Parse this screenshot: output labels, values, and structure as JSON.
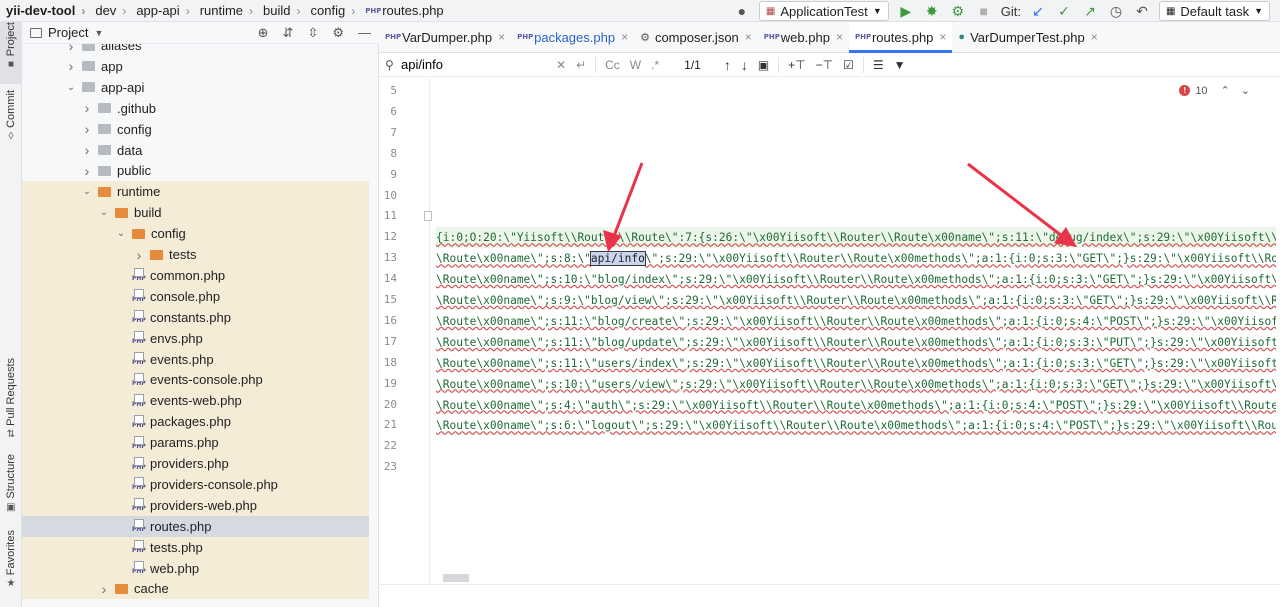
{
  "breadcrumbs": [
    "yii-dev-tool",
    "dev",
    "app-api",
    "runtime",
    "build",
    "config",
    "routes.php"
  ],
  "toolbar": {
    "run_config": "ApplicationTest",
    "git_label": "Git:",
    "default_task": "Default task"
  },
  "left_stripe": {
    "tabs": [
      "Project",
      "Commit",
      "Pull Requests",
      "Structure",
      "Favorites"
    ]
  },
  "project_panel": {
    "title": "Project",
    "tree": [
      {
        "label": "aliases",
        "type": "folder",
        "depth": 2,
        "chevron": "right",
        "color": "grey"
      },
      {
        "label": "app",
        "type": "folder",
        "depth": 2,
        "chevron": "right",
        "color": "grey"
      },
      {
        "label": "app-api",
        "type": "folder",
        "depth": 2,
        "chevron": "down",
        "color": "grey"
      },
      {
        "label": ".github",
        "type": "folder",
        "depth": 3,
        "chevron": "right",
        "color": "grey"
      },
      {
        "label": "config",
        "type": "folder",
        "depth": 3,
        "chevron": "right",
        "color": "grey"
      },
      {
        "label": "data",
        "type": "folder",
        "depth": 3,
        "chevron": "right",
        "color": "grey"
      },
      {
        "label": "public",
        "type": "folder",
        "depth": 3,
        "chevron": "right",
        "color": "grey"
      },
      {
        "label": "runtime",
        "type": "folder",
        "depth": 3,
        "chevron": "down",
        "color": "orange"
      },
      {
        "label": "build",
        "type": "folder",
        "depth": 4,
        "chevron": "down",
        "color": "orange"
      },
      {
        "label": "config",
        "type": "folder",
        "depth": 5,
        "chevron": "down",
        "color": "orange"
      },
      {
        "label": "tests",
        "type": "folder",
        "depth": 6,
        "chevron": "right",
        "color": "orange"
      },
      {
        "label": "common.php",
        "type": "php",
        "depth": 6
      },
      {
        "label": "console.php",
        "type": "php",
        "depth": 6
      },
      {
        "label": "constants.php",
        "type": "php",
        "depth": 6
      },
      {
        "label": "envs.php",
        "type": "php",
        "depth": 6
      },
      {
        "label": "events.php",
        "type": "php",
        "depth": 6
      },
      {
        "label": "events-console.php",
        "type": "php",
        "depth": 6
      },
      {
        "label": "events-web.php",
        "type": "php",
        "depth": 6
      },
      {
        "label": "packages.php",
        "type": "php",
        "depth": 6
      },
      {
        "label": "params.php",
        "type": "php",
        "depth": 6
      },
      {
        "label": "providers.php",
        "type": "php",
        "depth": 6
      },
      {
        "label": "providers-console.php",
        "type": "php",
        "depth": 6
      },
      {
        "label": "providers-web.php",
        "type": "php",
        "depth": 6
      },
      {
        "label": "routes.php",
        "type": "php",
        "depth": 6,
        "selected": true
      },
      {
        "label": "tests.php",
        "type": "php",
        "depth": 6
      },
      {
        "label": "web.php",
        "type": "php",
        "depth": 6
      },
      {
        "label": "cache",
        "type": "folder",
        "depth": 4,
        "chevron": "right",
        "color": "orange"
      }
    ]
  },
  "editor": {
    "tabs": [
      {
        "label": "VarDumper.php",
        "icon": "php",
        "blue": false
      },
      {
        "label": "packages.php",
        "icon": "php",
        "blue": true
      },
      {
        "label": "composer.json",
        "icon": "json",
        "blue": false
      },
      {
        "label": "web.php",
        "icon": "php",
        "blue": false
      },
      {
        "label": "routes.php",
        "icon": "php",
        "blue": false,
        "active": true
      },
      {
        "label": "VarDumperTest.php",
        "icon": "test",
        "blue": false
      }
    ],
    "find": {
      "query": "api/info",
      "match_count": "1/1",
      "case_label": "Cc",
      "word_label": "W",
      "regex_label": ".*"
    },
    "error_count": "10",
    "lines": [
      {
        "n": "5",
        "text": ""
      },
      {
        "n": "6",
        "text": ""
      },
      {
        "n": "7",
        "text": ""
      },
      {
        "n": "8",
        "text": ""
      },
      {
        "n": "9",
        "text": ""
      },
      {
        "n": "10",
        "text": ""
      },
      {
        "n": "11",
        "text": ""
      },
      {
        "n": "12",
        "text": "{i:0;O:20:\\\"Yiisoft\\\\Router\\\\Route\\\":7:{s:26:\\\"\\x00Yiisoft\\\\Router\\\\Route\\x00name\\\";s:11:\\\"debug/index\\\";s:29:\\\"\\x00Yiisoft\\\\Ro"
      },
      {
        "n": "13",
        "text_before": "\\Route\\x00name\\\";s:8:\\\"",
        "match": "api/info",
        "text_after": "\\\";s:29:\\\"\\x00Yiisoft\\\\Router\\\\Route\\x00methods\\\";a:1:{i:0;s:3:\\\"GET\\\";}s:29:\\\"\\x00Yiisoft\\\\Rout"
      },
      {
        "n": "14",
        "text": "\\Route\\x00name\\\";s:10:\\\"blog/index\\\";s:29:\\\"\\x00Yiisoft\\\\Router\\\\Route\\x00methods\\\";a:1:{i:0;s:3:\\\"GET\\\";}s:29:\\\"\\x00Yiisoft\\\\Rout"
      },
      {
        "n": "15",
        "text": "\\Route\\x00name\\\";s:9:\\\"blog/view\\\";s:29:\\\"\\x00Yiisoft\\\\Router\\\\Route\\x00methods\\\";a:1:{i:0;s:3:\\\"GET\\\";}s:29:\\\"\\x00Yiisoft\\\\Router"
      },
      {
        "n": "16",
        "text": "\\Route\\x00name\\\";s:11:\\\"blog/create\\\";s:29:\\\"\\x00Yiisoft\\\\Router\\\\Route\\x00methods\\\";a:1:{i:0;s:4:\\\"POST\\\";}s:29:\\\"\\x00Yiisoft\\"
      },
      {
        "n": "17",
        "text": "\\Route\\x00name\\\";s:11:\\\"blog/update\\\";s:29:\\\"\\x00Yiisoft\\\\Router\\\\Route\\x00methods\\\";a:1:{i:0;s:3:\\\"PUT\\\";}s:29:\\\"\\x00Yiisoft\\"
      },
      {
        "n": "18",
        "text": "\\Route\\x00name\\\";s:11:\\\"users/index\\\";s:29:\\\"\\x00Yiisoft\\\\Router\\\\Route\\x00methods\\\";a:1:{i:0;s:3:\\\"GET\\\";}s:29:\\\"\\x00Yiisoft\\"
      },
      {
        "n": "19",
        "text": "\\Route\\x00name\\\";s:10:\\\"users/view\\\";s:29:\\\"\\x00Yiisoft\\\\Router\\\\Route\\x00methods\\\";a:1:{i:0;s:3:\\\"GET\\\";}s:29:\\\"\\x00Yiisoft\\"
      },
      {
        "n": "20",
        "text": "\\Route\\x00name\\\";s:4:\\\"auth\\\";s:29:\\\"\\x00Yiisoft\\\\Router\\\\Route\\x00methods\\\";a:1:{i:0;s:4:\\\"POST\\\";}s:29:\\\"\\x00Yiisoft\\\\Router"
      },
      {
        "n": "21",
        "text": "\\Route\\x00name\\\";s:6:\\\"logout\\\";s:29:\\\"\\x00Yiisoft\\\\Router\\\\Route\\x00methods\\\";a:1:{i:0;s:4:\\\"POST\\\";}s:29:\\\"\\x00Yiisoft\\\\Rout"
      },
      {
        "n": "22",
        "text": ""
      },
      {
        "n": "23",
        "text": ""
      }
    ]
  },
  "colors": {
    "accent": "#3574f0",
    "arrow": "#e8334a",
    "code_string": "#1e6b35",
    "folder_orange": "#e68a3e",
    "folder_grey": "#b6bac1"
  }
}
